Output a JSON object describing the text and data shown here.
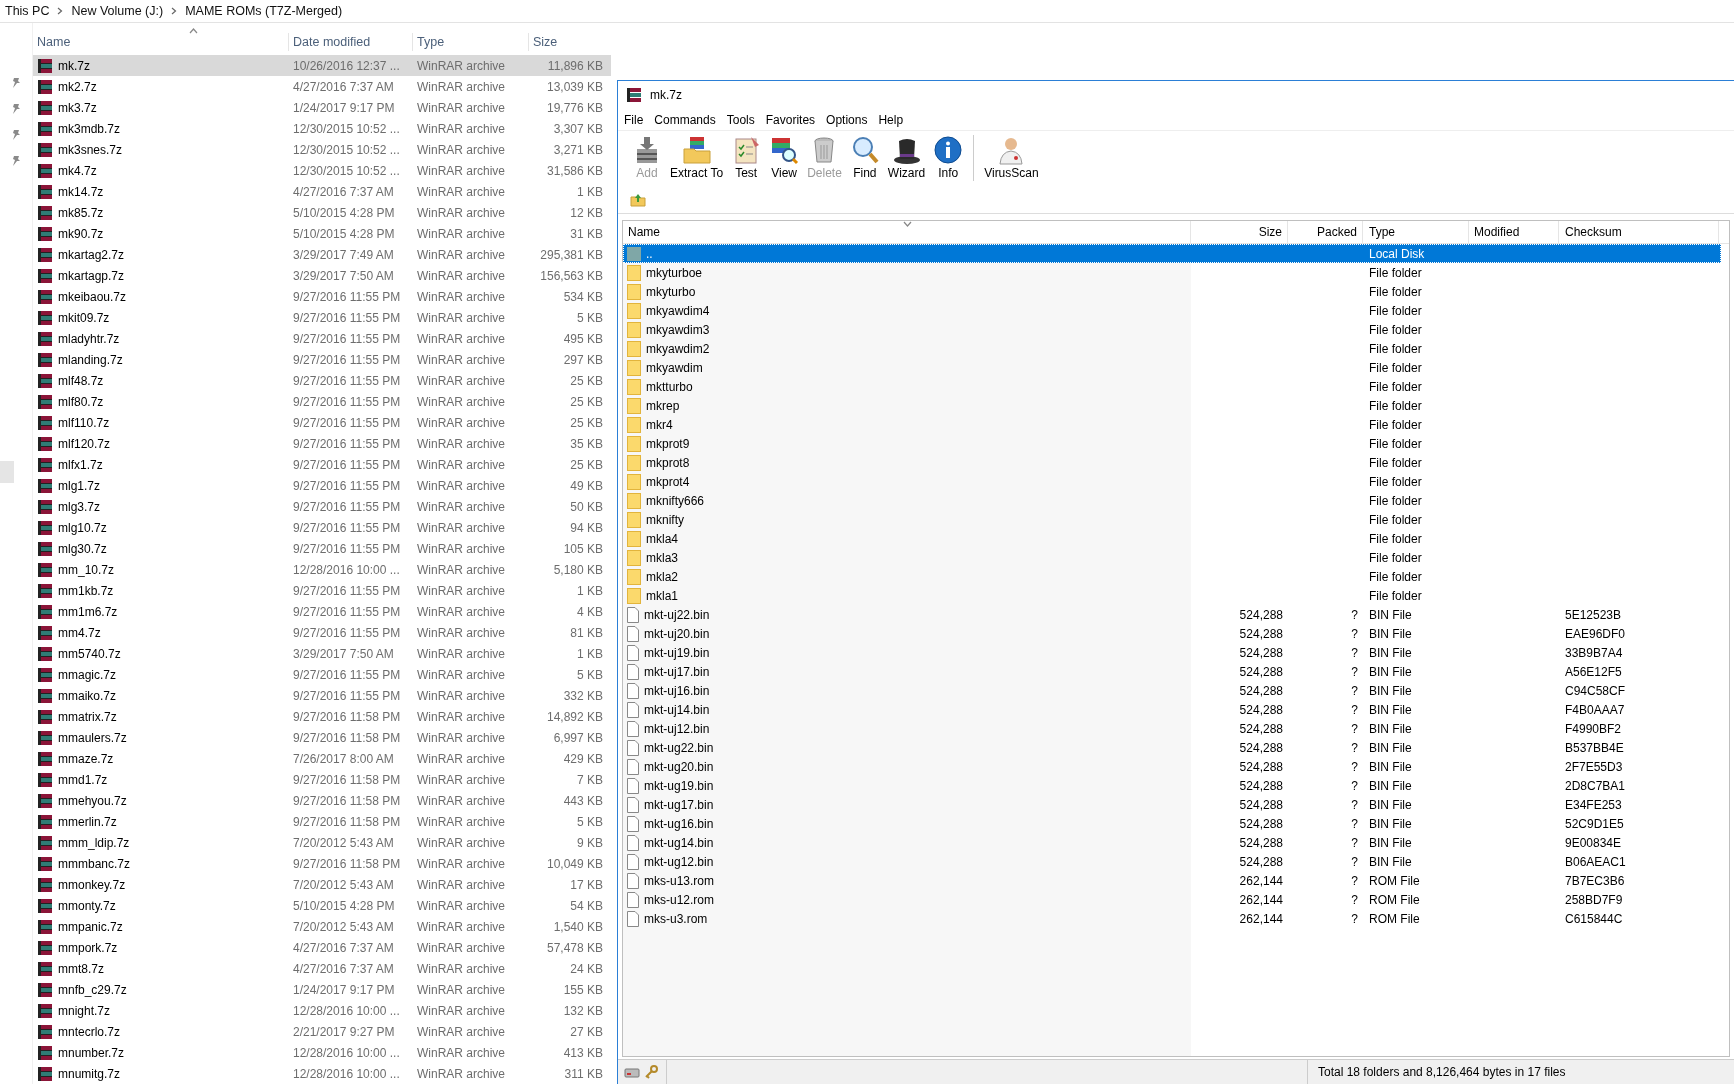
{
  "breadcrumb": [
    "This PC",
    "New Volume (J:)",
    "MAME ROMs (T7Z-Merged)"
  ],
  "explorer": {
    "columns": [
      "Name",
      "Date modified",
      "Type",
      "Size"
    ],
    "rows": [
      {
        "name": "mk.7z",
        "date": "10/26/2016 12:37 ...",
        "type": "WinRAR archive",
        "size": "11,896 KB",
        "selected": true
      },
      {
        "name": "mk2.7z",
        "date": "4/27/2016 7:37 AM",
        "type": "WinRAR archive",
        "size": "13,039 KB",
        "selected": false
      },
      {
        "name": "mk3.7z",
        "date": "1/24/2017 9:17 PM",
        "type": "WinRAR archive",
        "size": "19,776 KB",
        "selected": false
      },
      {
        "name": "mk3mdb.7z",
        "date": "12/30/2015 10:52 ...",
        "type": "WinRAR archive",
        "size": "3,307 KB",
        "selected": false
      },
      {
        "name": "mk3snes.7z",
        "date": "12/30/2015 10:52 ...",
        "type": "WinRAR archive",
        "size": "3,271 KB",
        "selected": false
      },
      {
        "name": "mk4.7z",
        "date": "12/30/2015 10:52 ...",
        "type": "WinRAR archive",
        "size": "31,586 KB",
        "selected": false
      },
      {
        "name": "mk14.7z",
        "date": "4/27/2016 7:37 AM",
        "type": "WinRAR archive",
        "size": "1 KB",
        "selected": false
      },
      {
        "name": "mk85.7z",
        "date": "5/10/2015 4:28 PM",
        "type": "WinRAR archive",
        "size": "12 KB",
        "selected": false
      },
      {
        "name": "mk90.7z",
        "date": "5/10/2015 4:28 PM",
        "type": "WinRAR archive",
        "size": "31 KB",
        "selected": false
      },
      {
        "name": "mkartag2.7z",
        "date": "3/29/2017 7:49 AM",
        "type": "WinRAR archive",
        "size": "295,381 KB",
        "selected": false
      },
      {
        "name": "mkartagp.7z",
        "date": "3/29/2017 7:50 AM",
        "type": "WinRAR archive",
        "size": "156,563 KB",
        "selected": false
      },
      {
        "name": "mkeibaou.7z",
        "date": "9/27/2016 11:55 PM",
        "type": "WinRAR archive",
        "size": "534 KB",
        "selected": false
      },
      {
        "name": "mkit09.7z",
        "date": "9/27/2016 11:55 PM",
        "type": "WinRAR archive",
        "size": "5 KB",
        "selected": false
      },
      {
        "name": "mladyhtr.7z",
        "date": "9/27/2016 11:55 PM",
        "type": "WinRAR archive",
        "size": "495 KB",
        "selected": false
      },
      {
        "name": "mlanding.7z",
        "date": "9/27/2016 11:55 PM",
        "type": "WinRAR archive",
        "size": "297 KB",
        "selected": false
      },
      {
        "name": "mlf48.7z",
        "date": "9/27/2016 11:55 PM",
        "type": "WinRAR archive",
        "size": "25 KB",
        "selected": false
      },
      {
        "name": "mlf80.7z",
        "date": "9/27/2016 11:55 PM",
        "type": "WinRAR archive",
        "size": "25 KB",
        "selected": false
      },
      {
        "name": "mlf110.7z",
        "date": "9/27/2016 11:55 PM",
        "type": "WinRAR archive",
        "size": "25 KB",
        "selected": false
      },
      {
        "name": "mlf120.7z",
        "date": "9/27/2016 11:55 PM",
        "type": "WinRAR archive",
        "size": "35 KB",
        "selected": false
      },
      {
        "name": "mlfx1.7z",
        "date": "9/27/2016 11:55 PM",
        "type": "WinRAR archive",
        "size": "25 KB",
        "selected": false
      },
      {
        "name": "mlg1.7z",
        "date": "9/27/2016 11:55 PM",
        "type": "WinRAR archive",
        "size": "49 KB",
        "selected": false
      },
      {
        "name": "mlg3.7z",
        "date": "9/27/2016 11:55 PM",
        "type": "WinRAR archive",
        "size": "50 KB",
        "selected": false
      },
      {
        "name": "mlg10.7z",
        "date": "9/27/2016 11:55 PM",
        "type": "WinRAR archive",
        "size": "94 KB",
        "selected": false
      },
      {
        "name": "mlg30.7z",
        "date": "9/27/2016 11:55 PM",
        "type": "WinRAR archive",
        "size": "105 KB",
        "selected": false
      },
      {
        "name": "mm_10.7z",
        "date": "12/28/2016 10:00 ...",
        "type": "WinRAR archive",
        "size": "5,180 KB",
        "selected": false
      },
      {
        "name": "mm1kb.7z",
        "date": "9/27/2016 11:55 PM",
        "type": "WinRAR archive",
        "size": "1 KB",
        "selected": false
      },
      {
        "name": "mm1m6.7z",
        "date": "9/27/2016 11:55 PM",
        "type": "WinRAR archive",
        "size": "4 KB",
        "selected": false
      },
      {
        "name": "mm4.7z",
        "date": "9/27/2016 11:55 PM",
        "type": "WinRAR archive",
        "size": "81 KB",
        "selected": false
      },
      {
        "name": "mm5740.7z",
        "date": "3/29/2017 7:50 AM",
        "type": "WinRAR archive",
        "size": "1 KB",
        "selected": false
      },
      {
        "name": "mmagic.7z",
        "date": "9/27/2016 11:55 PM",
        "type": "WinRAR archive",
        "size": "5 KB",
        "selected": false
      },
      {
        "name": "mmaiko.7z",
        "date": "9/27/2016 11:55 PM",
        "type": "WinRAR archive",
        "size": "332 KB",
        "selected": false
      },
      {
        "name": "mmatrix.7z",
        "date": "9/27/2016 11:58 PM",
        "type": "WinRAR archive",
        "size": "14,892 KB",
        "selected": false
      },
      {
        "name": "mmaulers.7z",
        "date": "9/27/2016 11:58 PM",
        "type": "WinRAR archive",
        "size": "6,997 KB",
        "selected": false
      },
      {
        "name": "mmaze.7z",
        "date": "7/26/2017 8:00 AM",
        "type": "WinRAR archive",
        "size": "429 KB",
        "selected": false
      },
      {
        "name": "mmd1.7z",
        "date": "9/27/2016 11:58 PM",
        "type": "WinRAR archive",
        "size": "7 KB",
        "selected": false
      },
      {
        "name": "mmehyou.7z",
        "date": "9/27/2016 11:58 PM",
        "type": "WinRAR archive",
        "size": "443 KB",
        "selected": false
      },
      {
        "name": "mmerlin.7z",
        "date": "9/27/2016 11:58 PM",
        "type": "WinRAR archive",
        "size": "5 KB",
        "selected": false
      },
      {
        "name": "mmm_ldip.7z",
        "date": "7/20/2012 5:43 AM",
        "type": "WinRAR archive",
        "size": "9 KB",
        "selected": false
      },
      {
        "name": "mmmbanc.7z",
        "date": "9/27/2016 11:58 PM",
        "type": "WinRAR archive",
        "size": "10,049 KB",
        "selected": false
      },
      {
        "name": "mmonkey.7z",
        "date": "7/20/2012 5:43 AM",
        "type": "WinRAR archive",
        "size": "17 KB",
        "selected": false
      },
      {
        "name": "mmonty.7z",
        "date": "5/10/2015 4:28 PM",
        "type": "WinRAR archive",
        "size": "54 KB",
        "selected": false
      },
      {
        "name": "mmpanic.7z",
        "date": "7/20/2012 5:43 AM",
        "type": "WinRAR archive",
        "size": "1,540 KB",
        "selected": false
      },
      {
        "name": "mmpork.7z",
        "date": "4/27/2016 7:37 AM",
        "type": "WinRAR archive",
        "size": "57,478 KB",
        "selected": false
      },
      {
        "name": "mmt8.7z",
        "date": "4/27/2016 7:37 AM",
        "type": "WinRAR archive",
        "size": "24 KB",
        "selected": false
      },
      {
        "name": "mnfb_c29.7z",
        "date": "1/24/2017 9:17 PM",
        "type": "WinRAR archive",
        "size": "155 KB",
        "selected": false
      },
      {
        "name": "mnight.7z",
        "date": "12/28/2016 10:00 ...",
        "type": "WinRAR archive",
        "size": "132 KB",
        "selected": false
      },
      {
        "name": "mntecrlo.7z",
        "date": "2/21/2017 9:27 PM",
        "type": "WinRAR archive",
        "size": "27 KB",
        "selected": false
      },
      {
        "name": "mnumber.7z",
        "date": "12/28/2016 10:00 ...",
        "type": "WinRAR archive",
        "size": "413 KB",
        "selected": false
      },
      {
        "name": "mnumitg.7z",
        "date": "12/28/2016 10:00 ...",
        "type": "WinRAR archive",
        "size": "311 KB",
        "selected": false
      }
    ]
  },
  "winrar": {
    "title": "mk.7z",
    "menu": [
      "File",
      "Commands",
      "Tools",
      "Favorites",
      "Options",
      "Help"
    ],
    "toolbar": [
      {
        "kind": "add",
        "label": "Add",
        "disabled": true
      },
      {
        "kind": "extract",
        "label": "Extract To",
        "disabled": false
      },
      {
        "kind": "test",
        "label": "Test",
        "disabled": false
      },
      {
        "kind": "view",
        "label": "View",
        "disabled": false
      },
      {
        "kind": "delete",
        "label": "Delete",
        "disabled": true
      },
      {
        "kind": "find",
        "label": "Find",
        "disabled": false
      },
      {
        "kind": "wizard",
        "label": "Wizard",
        "disabled": false
      },
      {
        "kind": "info",
        "label": "Info",
        "disabled": false
      },
      {
        "kind": "virusscan",
        "label": "VirusScan",
        "disabled": false
      }
    ],
    "columns": [
      "Name",
      "Size",
      "Packed",
      "Type",
      "Modified",
      "Checksum"
    ],
    "rows": [
      {
        "kind": "parent",
        "name": "..",
        "type": "Local Disk",
        "selected": true
      },
      {
        "kind": "folder",
        "name": "mkyturboe",
        "type": "File folder",
        "selected": false
      },
      {
        "kind": "folder",
        "name": "mkyturbo",
        "type": "File folder",
        "selected": false
      },
      {
        "kind": "folder",
        "name": "mkyawdim4",
        "type": "File folder",
        "selected": false
      },
      {
        "kind": "folder",
        "name": "mkyawdim3",
        "type": "File folder",
        "selected": false
      },
      {
        "kind": "folder",
        "name": "mkyawdim2",
        "type": "File folder",
        "selected": false
      },
      {
        "kind": "folder",
        "name": "mkyawdim",
        "type": "File folder",
        "selected": false
      },
      {
        "kind": "folder",
        "name": "mktturbo",
        "type": "File folder",
        "selected": false
      },
      {
        "kind": "folder",
        "name": "mkrep",
        "type": "File folder",
        "selected": false
      },
      {
        "kind": "folder",
        "name": "mkr4",
        "type": "File folder",
        "selected": false
      },
      {
        "kind": "folder",
        "name": "mkprot9",
        "type": "File folder",
        "selected": false
      },
      {
        "kind": "folder",
        "name": "mkprot8",
        "type": "File folder",
        "selected": false
      },
      {
        "kind": "folder",
        "name": "mkprot4",
        "type": "File folder",
        "selected": false
      },
      {
        "kind": "folder",
        "name": "mknifty666",
        "type": "File folder",
        "selected": false
      },
      {
        "kind": "folder",
        "name": "mknifty",
        "type": "File folder",
        "selected": false
      },
      {
        "kind": "folder",
        "name": "mkla4",
        "type": "File folder",
        "selected": false
      },
      {
        "kind": "folder",
        "name": "mkla3",
        "type": "File folder",
        "selected": false
      },
      {
        "kind": "folder",
        "name": "mkla2",
        "type": "File folder",
        "selected": false
      },
      {
        "kind": "folder",
        "name": "mkla1",
        "type": "File folder",
        "selected": false
      },
      {
        "kind": "file",
        "name": "mkt-uj22.bin",
        "size": "524,288",
        "packed": "?",
        "type": "BIN File",
        "checksum": "5E12523B",
        "selected": false
      },
      {
        "kind": "file",
        "name": "mkt-uj20.bin",
        "size": "524,288",
        "packed": "?",
        "type": "BIN File",
        "checksum": "EAE96DF0",
        "selected": false
      },
      {
        "kind": "file",
        "name": "mkt-uj19.bin",
        "size": "524,288",
        "packed": "?",
        "type": "BIN File",
        "checksum": "33B9B7A4",
        "selected": false
      },
      {
        "kind": "file",
        "name": "mkt-uj17.bin",
        "size": "524,288",
        "packed": "?",
        "type": "BIN File",
        "checksum": "A56E12F5",
        "selected": false
      },
      {
        "kind": "file",
        "name": "mkt-uj16.bin",
        "size": "524,288",
        "packed": "?",
        "type": "BIN File",
        "checksum": "C94C58CF",
        "selected": false
      },
      {
        "kind": "file",
        "name": "mkt-uj14.bin",
        "size": "524,288",
        "packed": "?",
        "type": "BIN File",
        "checksum": "F4B0AAA7",
        "selected": false
      },
      {
        "kind": "file",
        "name": "mkt-uj12.bin",
        "size": "524,288",
        "packed": "?",
        "type": "BIN File",
        "checksum": "F4990BF2",
        "selected": false
      },
      {
        "kind": "file",
        "name": "mkt-ug22.bin",
        "size": "524,288",
        "packed": "?",
        "type": "BIN File",
        "checksum": "B537BB4E",
        "selected": false
      },
      {
        "kind": "file",
        "name": "mkt-ug20.bin",
        "size": "524,288",
        "packed": "?",
        "type": "BIN File",
        "checksum": "2F7E55D3",
        "selected": false
      },
      {
        "kind": "file",
        "name": "mkt-ug19.bin",
        "size": "524,288",
        "packed": "?",
        "type": "BIN File",
        "checksum": "2D8C7BA1",
        "selected": false
      },
      {
        "kind": "file",
        "name": "mkt-ug17.bin",
        "size": "524,288",
        "packed": "?",
        "type": "BIN File",
        "checksum": "E34FE253",
        "selected": false
      },
      {
        "kind": "file",
        "name": "mkt-ug16.bin",
        "size": "524,288",
        "packed": "?",
        "type": "BIN File",
        "checksum": "52C9D1E5",
        "selected": false
      },
      {
        "kind": "file",
        "name": "mkt-ug14.bin",
        "size": "524,288",
        "packed": "?",
        "type": "BIN File",
        "checksum": "9E00834E",
        "selected": false
      },
      {
        "kind": "file",
        "name": "mkt-ug12.bin",
        "size": "524,288",
        "packed": "?",
        "type": "BIN File",
        "checksum": "B06AEAC1",
        "selected": false
      },
      {
        "kind": "file",
        "name": "mks-u13.rom",
        "size": "262,144",
        "packed": "?",
        "type": "ROM File",
        "checksum": "7B7EC3B6",
        "selected": false
      },
      {
        "kind": "file",
        "name": "mks-u12.rom",
        "size": "262,144",
        "packed": "?",
        "type": "ROM File",
        "checksum": "258BD7F9",
        "selected": false
      },
      {
        "kind": "file",
        "name": "mks-u3.rom",
        "size": "262,144",
        "packed": "?",
        "type": "ROM File",
        "checksum": "C615844C",
        "selected": false
      }
    ],
    "status": "Total 18 folders and 8,126,464 bytes in 17 files"
  }
}
